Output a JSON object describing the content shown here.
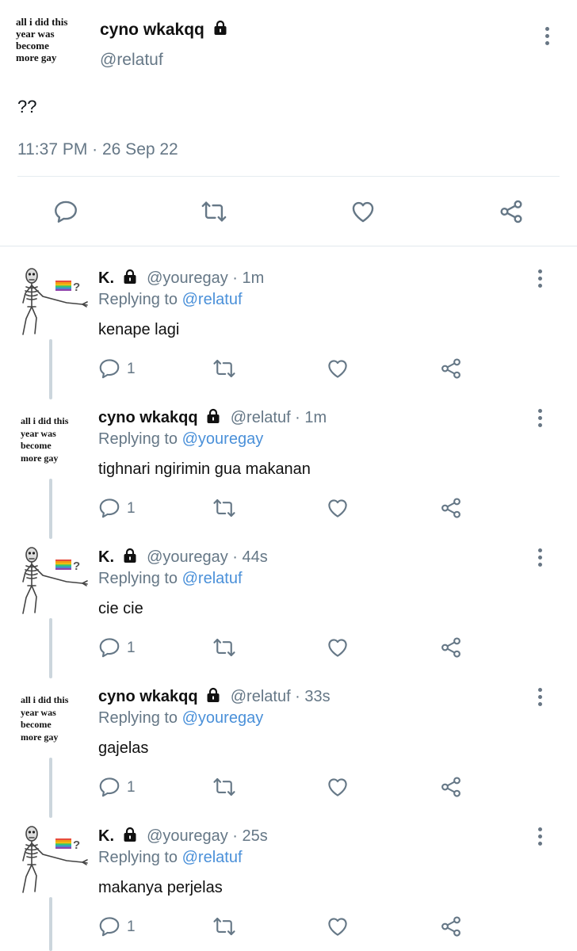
{
  "main_tweet": {
    "avatar_text": [
      "all i did this",
      "year was",
      "become",
      "more gay"
    ],
    "name": "cyno wkakqq",
    "handle": "@relatuf",
    "text": "??",
    "timestamp": "11:37 PM · 26 Sep 22",
    "actions": [
      "reply-icon",
      "retweet-icon",
      "like-icon",
      "share-icon"
    ]
  },
  "replies": [
    {
      "name": "K.",
      "handle": "@youregay · 1m",
      "replying_label": "Replying to",
      "replying_to": "@relatuf",
      "text": "kenape lagi",
      "reply_count": "1",
      "avatar": "skeleton-rainbow-flag"
    },
    {
      "name": "cyno wkakqq",
      "handle": "@relatuf · 1m",
      "replying_label": "Replying to",
      "replying_to": "@youregay",
      "text": "tighnari ngirimin gua makanan",
      "reply_count": "1",
      "avatar": "text-avatar"
    },
    {
      "name": "K.",
      "handle": "@youregay · 44s",
      "replying_label": "Replying to",
      "replying_to": "@relatuf",
      "text": "cie cie",
      "reply_count": "1",
      "avatar": "skeleton-rainbow-flag"
    },
    {
      "name": "cyno wkakqq",
      "handle": "@relatuf · 33s",
      "replying_label": "Replying to",
      "replying_to": "@youregay",
      "text": "gajelas",
      "reply_count": "1",
      "avatar": "text-avatar"
    },
    {
      "name": "K.",
      "handle": "@youregay · 25s",
      "replying_label": "Replying to",
      "replying_to": "@relatuf",
      "text": "makanya perjelas",
      "reply_count": "1",
      "avatar": "skeleton-rainbow-flag"
    }
  ],
  "colors": {
    "link": "#4a90d9",
    "muted": "#657786",
    "icon": "#657786"
  }
}
